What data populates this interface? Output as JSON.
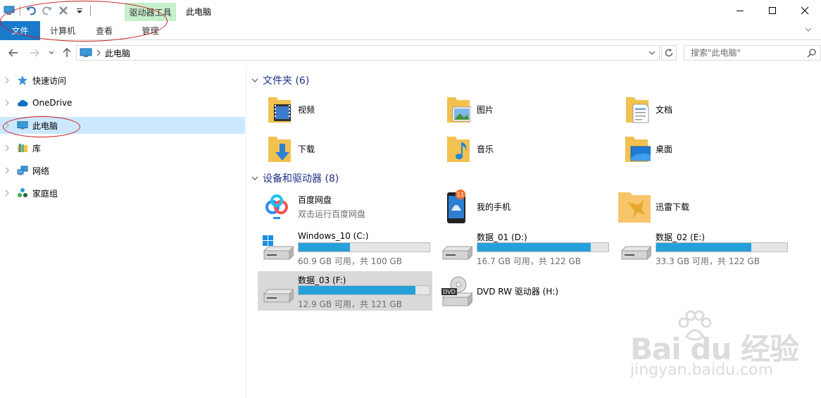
{
  "window": {
    "title": "此电脑",
    "context_tab": "驱动器工具",
    "accent": "#1979ca"
  },
  "quick_access_toolbar": [
    "computer-icon",
    "undo-icon",
    "redo-icon",
    "delete-icon",
    "customize-dropdown-icon"
  ],
  "ribbon": {
    "tabs": [
      "文件",
      "计算机",
      "查看",
      "管理"
    ]
  },
  "address": {
    "path": "此电脑",
    "search_placeholder": "搜索\"此电脑\""
  },
  "nav_pane": {
    "items": [
      {
        "label": "快速访问",
        "icon": "star-icon"
      },
      {
        "label": "OneDrive",
        "icon": "cloud-icon"
      },
      {
        "label": "此电脑",
        "icon": "computer-icon",
        "selected": true
      },
      {
        "label": "库",
        "icon": "library-icon"
      },
      {
        "label": "网络",
        "icon": "network-icon"
      },
      {
        "label": "家庭组",
        "icon": "homegroup-icon"
      }
    ]
  },
  "folders_group": {
    "title": "文件夹 (6)",
    "items": [
      {
        "label": "视频",
        "icon": "videos-folder-icon"
      },
      {
        "label": "图片",
        "icon": "pictures-folder-icon"
      },
      {
        "label": "文档",
        "icon": "documents-folder-icon"
      },
      {
        "label": "下载",
        "icon": "downloads-folder-icon"
      },
      {
        "label": "音乐",
        "icon": "music-folder-icon"
      },
      {
        "label": "桌面",
        "icon": "desktop-folder-icon"
      }
    ]
  },
  "devices_group": {
    "title": "设备和驱动器 (8)",
    "apps": [
      {
        "name": "百度网盘",
        "sub": "双击运行百度网盘",
        "icon": "baidu-netdisk-icon"
      },
      {
        "name": "我的手机",
        "sub": "",
        "icon": "phone-icon",
        "badge": "11"
      },
      {
        "name": "迅雷下载",
        "sub": "",
        "icon": "xunlei-icon"
      }
    ],
    "drives": [
      {
        "name": "Windows_10 (C:)",
        "info": "60.9 GB 可用，共 100 GB",
        "used": 0.391,
        "icon": "windows-drive-icon"
      },
      {
        "name": "数据_01 (D:)",
        "info": "16.7 GB 可用，共 122 GB",
        "used": 0.863,
        "icon": "hard-drive-icon"
      },
      {
        "name": "数据_02 (E:)",
        "info": "33.3 GB 可用，共 122 GB",
        "used": 0.727,
        "icon": "hard-drive-icon"
      },
      {
        "name": "数据_03 (F:)",
        "info": "12.9 GB 可用，共 121 GB",
        "used": 0.893,
        "icon": "hard-drive-icon",
        "selected": true
      },
      {
        "name": "DVD RW 驱动器 (H:)",
        "info": "",
        "icon": "dvd-drive-icon"
      }
    ]
  },
  "watermark": {
    "brand": "Bai du 经验",
    "url": "jingyan.baidu.com"
  }
}
